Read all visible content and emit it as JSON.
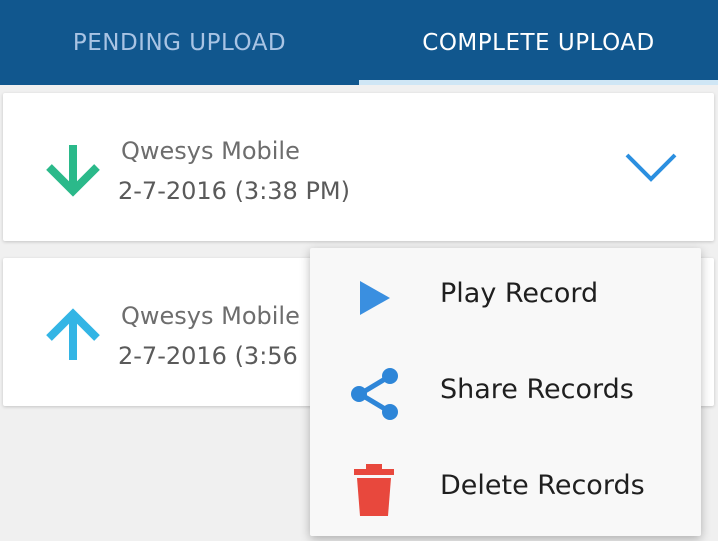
{
  "tabs": {
    "pending_label": "PENDING UPLOAD",
    "complete_label": "COMPLETE UPLOAD",
    "active": "complete"
  },
  "records": [
    {
      "title": "Qwesys Mobile",
      "date": "2-7-2016 (3:38 PM)",
      "direction_icon": "arrow-down-icon",
      "direction_color": "#2bb98a"
    },
    {
      "title": "Qwesys Mobile",
      "date": "2-7-2016 (3:56",
      "direction_icon": "arrow-up-icon",
      "direction_color": "#33b5e5"
    }
  ],
  "menu": {
    "items": [
      {
        "label": "Play Record",
        "icon": "play-icon",
        "color": "#3a8fe0"
      },
      {
        "label": "Share Records",
        "icon": "share-icon",
        "color": "#2e86d8"
      },
      {
        "label": "Delete Records",
        "icon": "trash-icon",
        "color": "#e8483d"
      }
    ]
  },
  "colors": {
    "header": "#11578e",
    "chevron": "#2b8fe0"
  }
}
